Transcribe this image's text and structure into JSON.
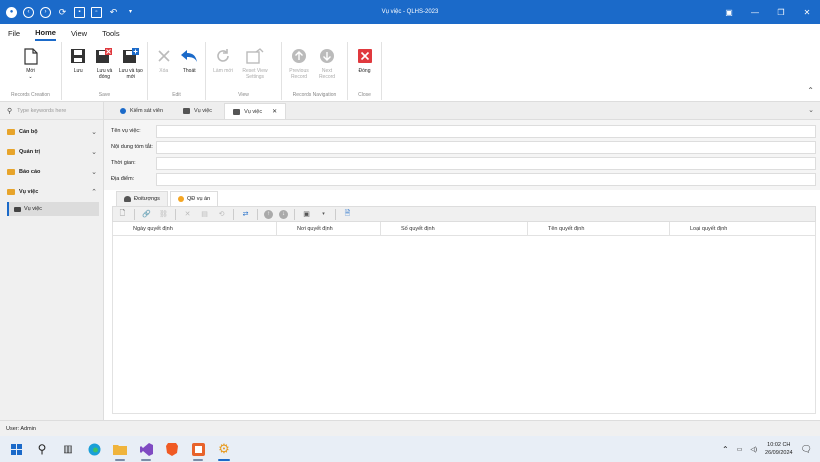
{
  "window": {
    "title": "Vụ việc - QLHS-2023"
  },
  "menu": {
    "tabs": [
      "File",
      "Home",
      "View",
      "Tools"
    ]
  },
  "ribbon": {
    "groups": {
      "records_creation": {
        "name": "Records Creation",
        "new_label": "Mới"
      },
      "save": {
        "name": "Save",
        "save_label": "Lưu",
        "save_close_label": "Lưu và đóng",
        "save_new_label": "Lưu và tạo mới"
      },
      "edit": {
        "name": "Edit",
        "delete_label": "Xóa",
        "undo_label": "Thoát"
      },
      "view": {
        "name": "View",
        "refresh_label": "Làm mới",
        "reset_label": "Reset View Settings"
      },
      "nav": {
        "name": "Records Navigation",
        "prev_label": "Previous Record",
        "next_label": "Next Record"
      },
      "close": {
        "name": "Close",
        "close_label": "Đóng"
      }
    }
  },
  "sidebar": {
    "search_placeholder": "Type keywords here",
    "groups": [
      {
        "label": "Cán bộ"
      },
      {
        "label": "Quản trị"
      },
      {
        "label": "Báo cáo"
      },
      {
        "label": "Vụ việc"
      }
    ],
    "items": [
      {
        "label": "Vụ việc"
      }
    ]
  },
  "doc_tabs": [
    {
      "label": "Kiểm sát viên"
    },
    {
      "label": "Vụ việc"
    },
    {
      "label": "Vụ việc"
    }
  ],
  "form": {
    "fields": [
      {
        "label": "Tên vụ việc:",
        "value": ""
      },
      {
        "label": "Nội dung tóm tắt:",
        "value": ""
      },
      {
        "label": "Thời gian:",
        "value": ""
      },
      {
        "label": "Địa điểm:",
        "value": ""
      }
    ]
  },
  "sub_tabs": [
    {
      "label": "Đoitượngs"
    },
    {
      "label": "QĐ vụ án"
    }
  ],
  "grid": {
    "columns": [
      "Ngày quyết định",
      "Nơi quyết định",
      "Số quyết định",
      "Tên quyết định",
      "Loại quyết định"
    ]
  },
  "status": {
    "user": "User: Admin"
  },
  "taskbar": {
    "time": "10:02 CH",
    "date": "26/09/2024"
  },
  "colors": {
    "accent": "#1b6ac9",
    "folder": "#e7a42b",
    "close_red": "#e0393e"
  }
}
